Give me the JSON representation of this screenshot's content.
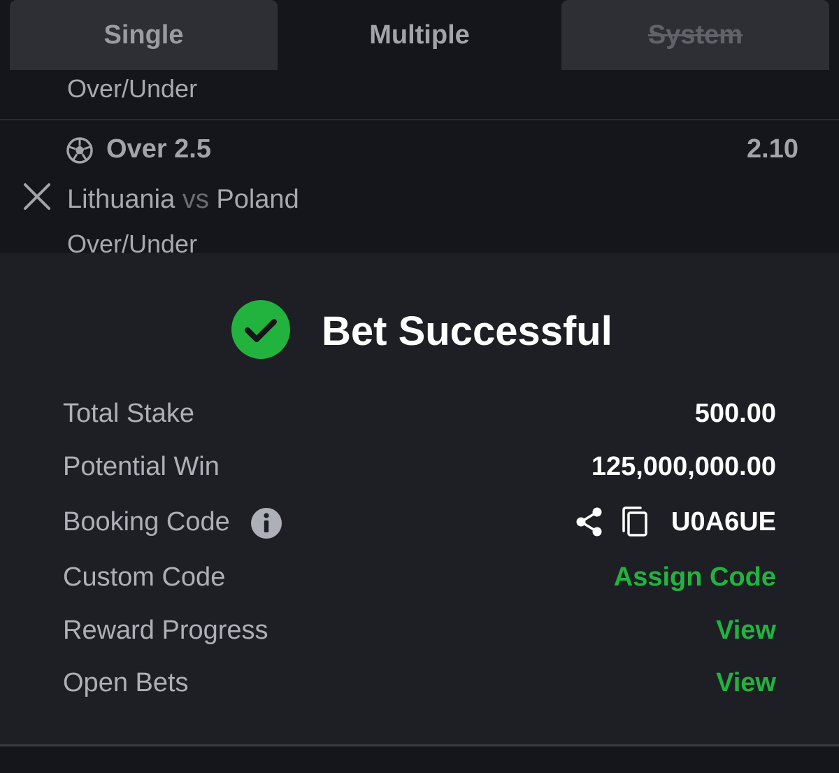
{
  "tabs": [
    {
      "label": "Single"
    },
    {
      "label": "Multiple"
    },
    {
      "label": "System"
    }
  ],
  "selections": {
    "previous_market": "Over/Under",
    "pick": "Over 2.5",
    "odds": "2.10",
    "home": "Lithuania",
    "vs": "vs",
    "away": "Poland",
    "market": "Over/Under"
  },
  "result": {
    "title": "Bet Successful",
    "total_stake_label": "Total Stake",
    "total_stake": "500.00",
    "potential_win_label": "Potential Win",
    "potential_win": "125,000,000.00",
    "booking_code_label": "Booking Code",
    "booking_code": "U0A6UE",
    "custom_code_label": "Custom Code",
    "custom_code_action": "Assign Code",
    "reward_progress_label": "Reward Progress",
    "reward_progress_action": "View",
    "open_bets_label": "Open Bets",
    "open_bets_action": "View"
  },
  "colors": {
    "success_green": "#22b33f",
    "panel_bg": "#1e1f25",
    "page_bg": "#15161b"
  },
  "icons": [
    "soccer-ball-icon",
    "close-icon",
    "check-circle-icon",
    "info-icon",
    "share-icon",
    "copy-icon"
  ]
}
